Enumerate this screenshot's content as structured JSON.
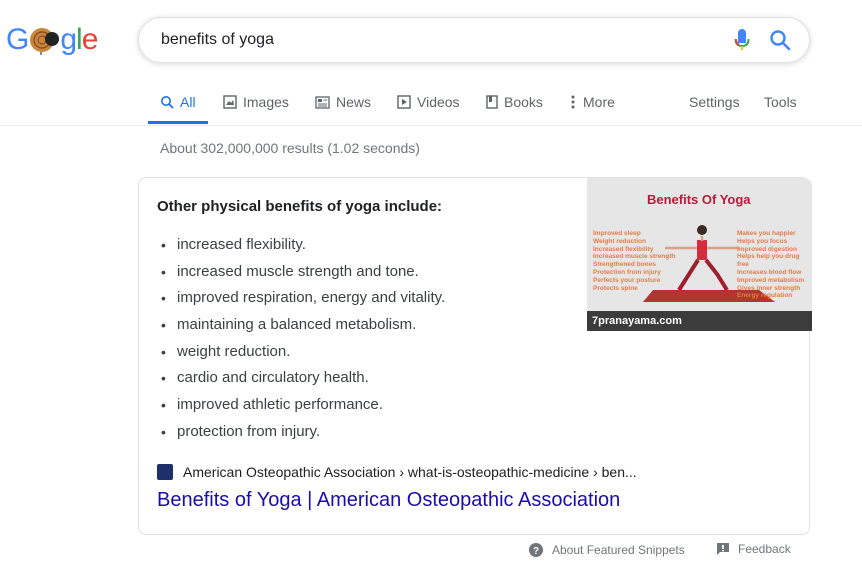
{
  "logo": {
    "letters": [
      "G",
      "o",
      "o",
      "g",
      "l",
      "e"
    ]
  },
  "search": {
    "query": "benefits of yoga"
  },
  "tabs": [
    {
      "label": "All",
      "icon": "search-icon",
      "active": true
    },
    {
      "label": "Images",
      "icon": "image-icon"
    },
    {
      "label": "News",
      "icon": "news-icon"
    },
    {
      "label": "Videos",
      "icon": "video-icon"
    },
    {
      "label": "Books",
      "icon": "book-icon"
    },
    {
      "label": "More",
      "icon": "more-vert-icon"
    },
    {
      "label": "Settings"
    },
    {
      "label": "Tools"
    }
  ],
  "results": {
    "stats": "About 302,000,000 results (1.02 seconds)"
  },
  "featured": {
    "title": "Other physical benefits of yoga include:",
    "bullets": [
      "increased flexibility.",
      "increased muscle strength and tone.",
      "improved respiration, energy and vitality.",
      "maintaining a balanced metabolism.",
      "weight reduction.",
      "cardio and circulatory health.",
      "improved athletic performance.",
      "protection from injury."
    ],
    "image": {
      "title": "Benefits Of Yoga",
      "caption": "7pranayama.com",
      "left_labels": [
        "Improved sleep",
        "Weight reduction",
        "Increased flexibility",
        "Increased muscle strength",
        "Strengthened bones",
        "Protection from injury",
        "Perfects your posture",
        "Protects spine"
      ],
      "right_labels": [
        "Makes you happier",
        "Helps you focus",
        "Improved digestion",
        "Helps help you drug free",
        "Increases blood flow",
        "Improved metabolism",
        "Gives inner strength",
        "Energy regulation"
      ]
    },
    "source": "American Osteopathic Association › what-is-osteopathic-medicine › ben...",
    "link": "Benefits of Yoga | American Osteopathic Association"
  },
  "footer": {
    "about": "About Featured Snippets",
    "feedback": "Feedback"
  },
  "colors": {
    "accent": "#1a73e8",
    "link": "#1a0dab",
    "muted": "#70757a"
  }
}
